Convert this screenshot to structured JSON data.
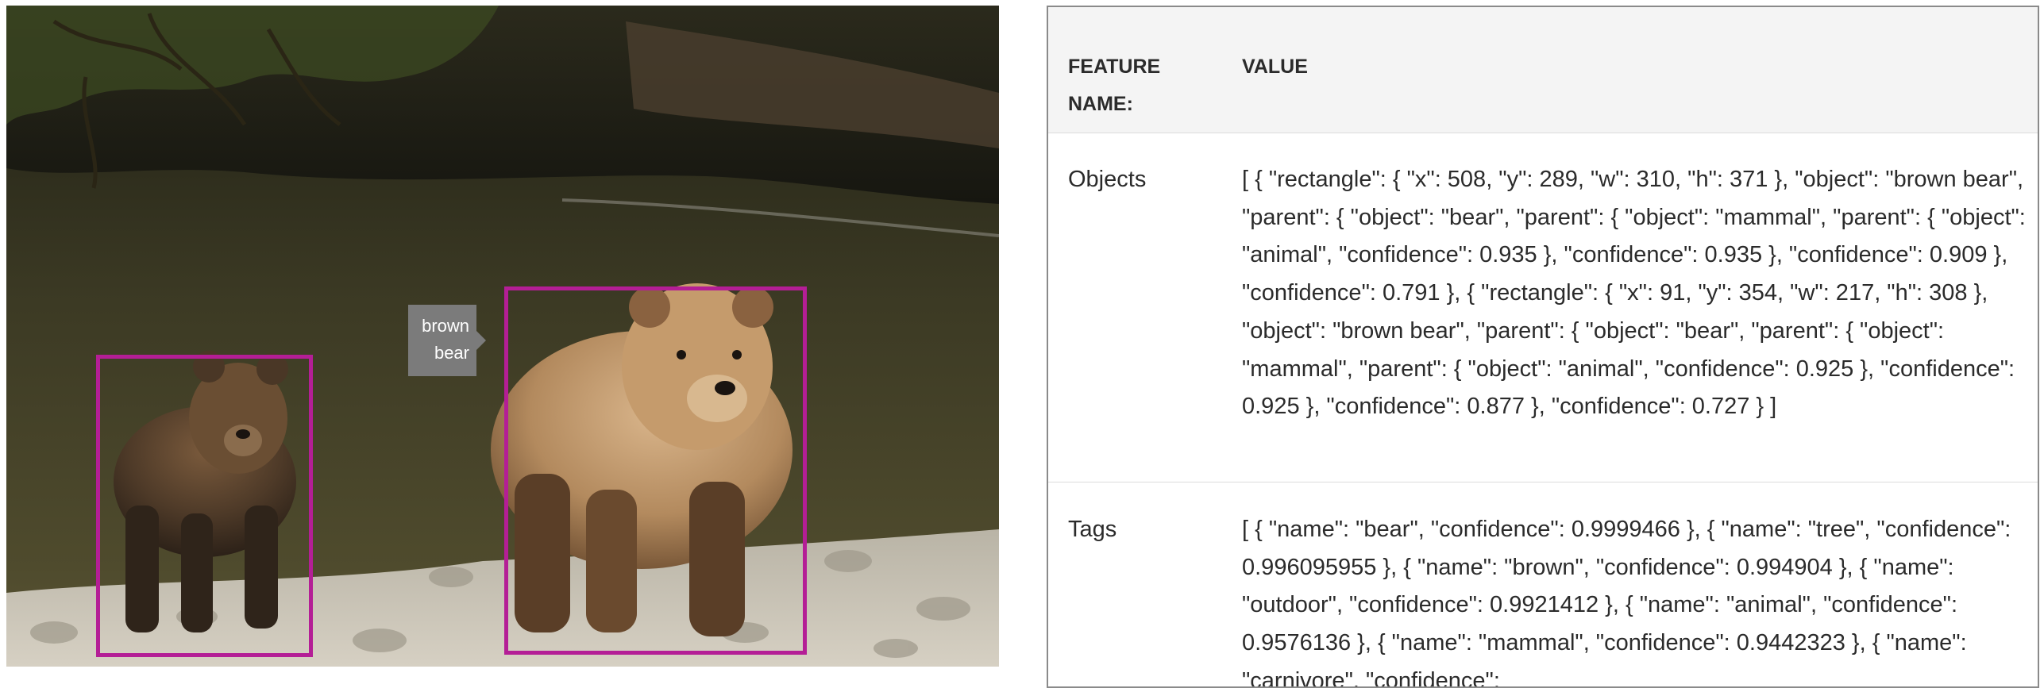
{
  "image": {
    "description_icon": "photo-two-brown-bears-river",
    "detections": [
      {
        "label_lines": [
          "brown",
          "bear"
        ]
      }
    ],
    "box_color": "#b41e96"
  },
  "table": {
    "header": {
      "name": "FEATURE NAME:",
      "value": "VALUE"
    },
    "rows": [
      {
        "name": "Objects",
        "value": "[ { \"rectangle\": { \"x\": 508, \"y\": 289, \"w\": 310, \"h\": 371 }, \"object\": \"brown bear\", \"parent\": { \"object\": \"bear\", \"parent\": { \"object\": \"mammal\", \"parent\": { \"object\": \"animal\", \"confidence\": 0.935 }, \"confidence\": 0.935 }, \"confidence\": 0.909 }, \"confidence\": 0.791 }, { \"rectangle\": { \"x\": 91, \"y\": 354, \"w\": 217, \"h\": 308 }, \"object\": \"brown bear\", \"parent\": { \"object\": \"bear\", \"parent\": { \"object\": \"mammal\", \"parent\": { \"object\": \"animal\", \"confidence\": 0.925 }, \"confidence\": 0.925 }, \"confidence\": 0.877 }, \"confidence\": 0.727 } ]"
      },
      {
        "name": "Tags",
        "value": "[ { \"name\": \"bear\", \"confidence\": 0.9999466 }, { \"name\": \"tree\", \"confidence\": 0.996095955 }, { \"name\": \"brown\", \"confidence\": 0.994904 }, { \"name\": \"outdoor\", \"confidence\": 0.9921412 }, { \"name\": \"animal\", \"confidence\": 0.9576136 }, { \"name\": \"mammal\", \"confidence\": 0.9442323 }, { \"name\": \"carnivore\", \"confidence\":"
      }
    ]
  }
}
